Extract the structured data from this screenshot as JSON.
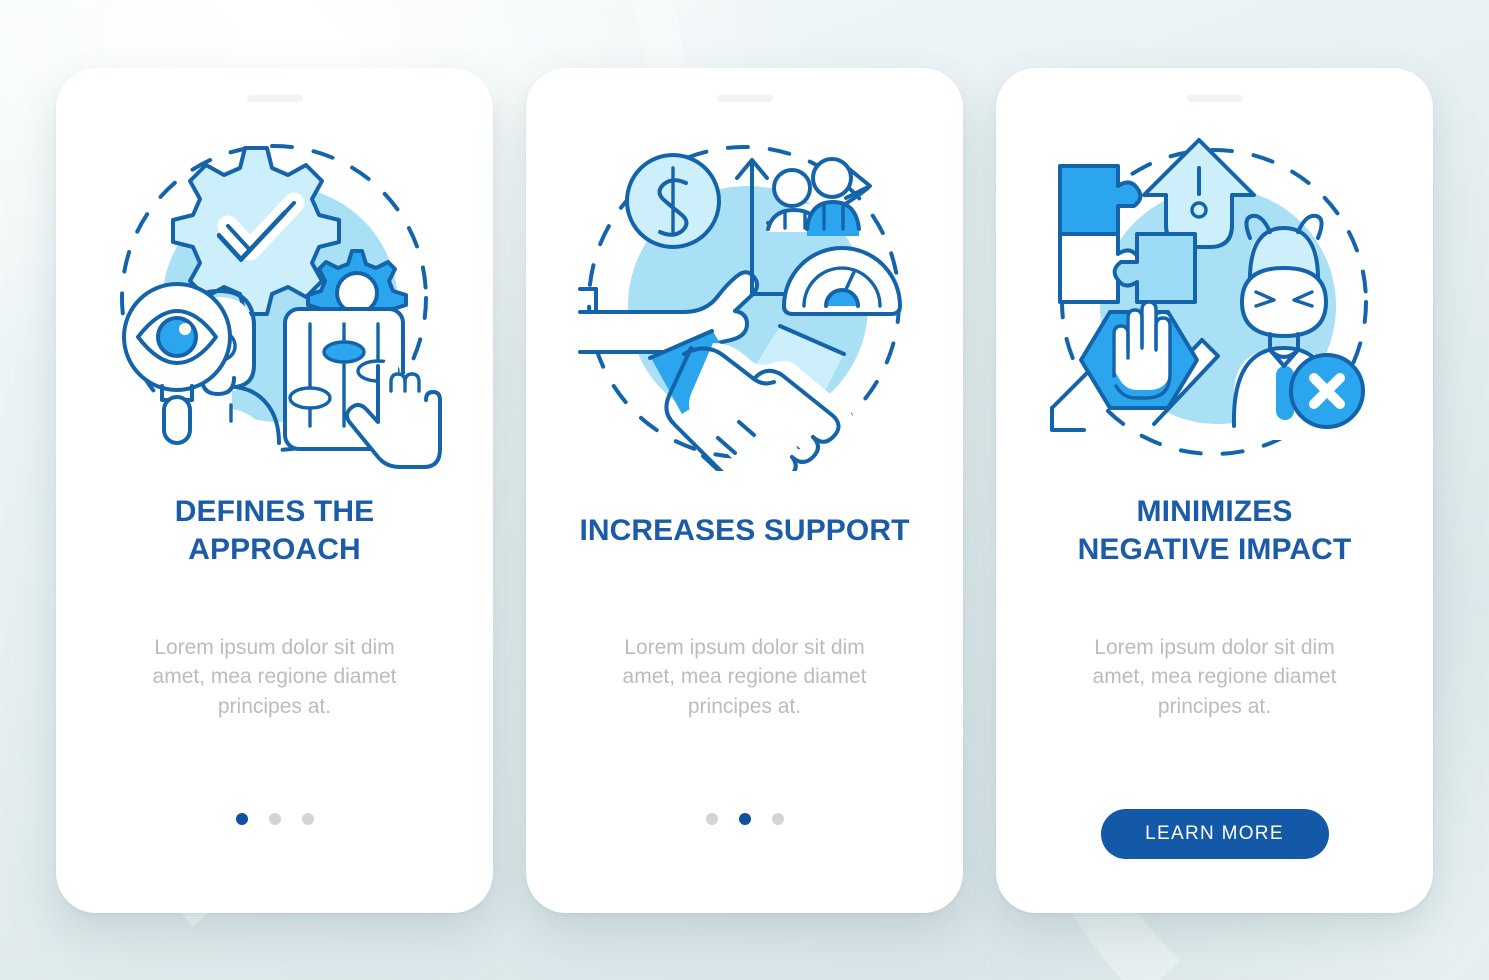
{
  "theme": {
    "title_color": "#1b5ba8",
    "desc_color": "#b9bcc0",
    "accent_blue": "#2ba6ee",
    "button_color": "#1458a8",
    "dot_active_color": "#11509e",
    "dot_inactive_color": "#d2d4d6",
    "background_color": "#e6eff1",
    "phone_color": "#ffffff"
  },
  "screens": [
    {
      "id": "screen-defines-the-approach",
      "title": "DEFINES THE\nAPPROACH",
      "title_lines": [
        "DEFINES THE",
        "APPROACH"
      ],
      "description": "Lorem ipsum dolor sit dim amet, mea regione diamet principes at.",
      "illustration": "magnifier-gear-checkmark-sliders-icon",
      "footer_type": "dots",
      "dots": {
        "count": 3,
        "active_index": 0
      }
    },
    {
      "id": "screen-increases-support",
      "title": "INCREASES SUPPORT",
      "title_lines": [
        "INCREASES SUPPORT"
      ],
      "description": "Lorem ipsum dolor sit dim amet, mea regione diamet principes at.",
      "illustration": "handshake-dollar-growth-gauge-icon",
      "footer_type": "dots",
      "dots": {
        "count": 3,
        "active_index": 1
      }
    },
    {
      "id": "screen-minimizes-negative-impact",
      "title": "MINIMIZES\nNEGATIVE IMPACT",
      "title_lines": [
        "MINIMIZES",
        "NEGATIVE IMPACT"
      ],
      "description": "Lorem ipsum dolor sit dim amet, mea regione diamet principes at.",
      "illustration": "puzzle-warning-devil-stop-hand-icon",
      "footer_type": "button",
      "button_label": "LEARN MORE"
    }
  ]
}
